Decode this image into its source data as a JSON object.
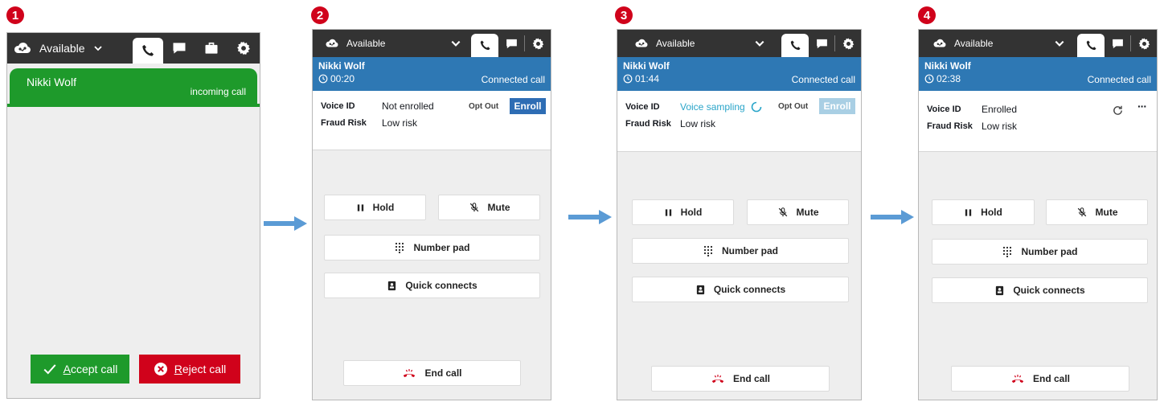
{
  "steps": [
    "1",
    "2",
    "3",
    "4"
  ],
  "panel1": {
    "status": "Available",
    "contact_name": "Nikki Wolf",
    "call_state": "incoming call",
    "accept_label": "Accept call",
    "reject_label": "Reject call"
  },
  "panel2": {
    "status": "Available",
    "contact_name": "Nikki Wolf",
    "timer": "00:20",
    "call_state": "Connected call",
    "voice_id_label": "Voice ID",
    "voice_id_value": "Not enrolled",
    "fraud_label": "Fraud Risk",
    "fraud_value": "Low risk",
    "opt_out": "Opt Out",
    "enroll": "Enroll",
    "hold": "Hold",
    "mute": "Mute",
    "number_pad": "Number pad",
    "quick_connects": "Quick connects",
    "end_call": "End call"
  },
  "panel3": {
    "status": "Available",
    "contact_name": "Nikki Wolf",
    "timer": "01:44",
    "call_state": "Connected call",
    "voice_id_label": "Voice ID",
    "voice_id_value": "Voice sampling",
    "fraud_label": "Fraud Risk",
    "fraud_value": "Low risk",
    "opt_out": "Opt Out",
    "enroll": "Enroll",
    "hold": "Hold",
    "mute": "Mute",
    "number_pad": "Number pad",
    "quick_connects": "Quick connects",
    "end_call": "End call"
  },
  "panel4": {
    "status": "Available",
    "contact_name": "Nikki Wolf",
    "timer": "02:38",
    "call_state": "Connected call",
    "voice_id_label": "Voice ID",
    "voice_id_value": "Enrolled",
    "fraud_label": "Fraud Risk",
    "fraud_value": "Low risk",
    "hold": "Hold",
    "mute": "Mute",
    "number_pad": "Number pad",
    "quick_connects": "Quick connects",
    "end_call": "End call"
  },
  "colors": {
    "topbar": "#333333",
    "incoming": "#1e9a2b",
    "connected_header": "#2e78b4",
    "reject": "#d0021b",
    "badge": "#d0021b",
    "flow_arrow": "#5b9bd5"
  },
  "icons": [
    "cloud-status-icon",
    "chevron-down-icon",
    "phone-icon",
    "chat-icon",
    "briefcase-icon",
    "gear-icon",
    "clock-icon",
    "spinner-icon",
    "refresh-icon",
    "more-icon",
    "pause-icon",
    "mic-off-icon",
    "keypad-icon",
    "contacts-book-icon",
    "end-call-icon",
    "check-icon",
    "x-circle-icon"
  ]
}
